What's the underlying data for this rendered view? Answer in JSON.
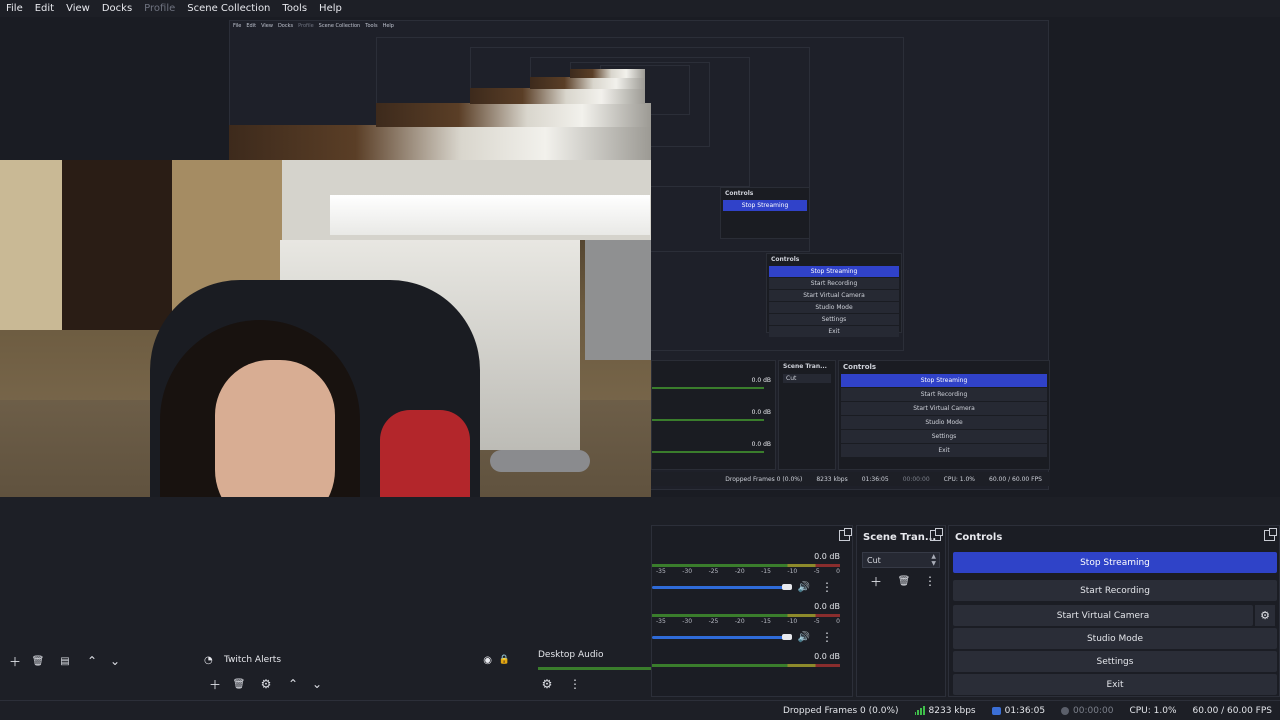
{
  "menu": {
    "items": [
      "File",
      "Edit",
      "View",
      "Docks",
      "Profile",
      "Scene Collection",
      "Tools",
      "Help"
    ],
    "disabled_index": 4
  },
  "nested_preview": {
    "controls_title": "Controls",
    "transitions_title": "Scene Tran...",
    "transition_value": "Cut",
    "buttons": [
      "Stop Streaming",
      "Start Recording",
      "Start Virtual Camera",
      "Studio Mode",
      "Settings",
      "Exit"
    ],
    "mixer_db": [
      "0.0 dB",
      "0.0 dB",
      "0.0 dB"
    ],
    "status": {
      "dropped": "Dropped Frames 0 (0.0%)",
      "kbps": "8233 kbps",
      "stream_time": "01:36:05",
      "rec_time": "00:00:00",
      "cpu": "CPU: 1.0%",
      "fps": "60.00 / 60.00 FPS"
    }
  },
  "docks": {
    "transitions": {
      "title": "Scene Tran...",
      "value": "Cut"
    },
    "controls": {
      "title": "Controls",
      "stop_streaming": "Stop Streaming",
      "start_recording": "Start Recording",
      "start_virtual_camera": "Start Virtual Camera",
      "studio_mode": "Studio Mode",
      "settings": "Settings",
      "exit": "Exit"
    },
    "mixer": {
      "channels": [
        {
          "db": "0.0 dB",
          "ticks": [
            "-35",
            "-30",
            "-25",
            "-20",
            "-15",
            "-10",
            "-5",
            "0"
          ]
        },
        {
          "db": "0.0 dB",
          "ticks": [
            "-35",
            "-30",
            "-25",
            "-20",
            "-15",
            "-10",
            "-5",
            "0"
          ]
        },
        {
          "db": "0.0 dB",
          "label": "Desktop Audio"
        }
      ]
    },
    "sources": {
      "selected": "Twitch Alerts"
    }
  },
  "statusbar": {
    "dropped": "Dropped Frames 0 (0.0%)",
    "kbps": "8233 kbps",
    "stream_time": "01:36:05",
    "rec_time": "00:00:00",
    "cpu": "CPU: 1.0%",
    "fps": "60.00 / 60.00 FPS"
  },
  "colors": {
    "accent": "#2f43c8",
    "background": "#1d1f26",
    "panel": "#1b1d24",
    "meter_green": "#3a7d2c",
    "meter_yellow": "#8d8a2b",
    "meter_red": "#8a2d2d"
  },
  "icons": {
    "add": "plus-icon",
    "remove": "trash-icon",
    "filter": "filter-icon",
    "up": "chevron-up-icon",
    "down": "chevron-down-icon",
    "more": "kebab-icon",
    "gear": "gear-icon",
    "volume": "speaker-icon",
    "eye": "eye-icon",
    "lock": "lock-icon",
    "popout": "popout-icon"
  }
}
